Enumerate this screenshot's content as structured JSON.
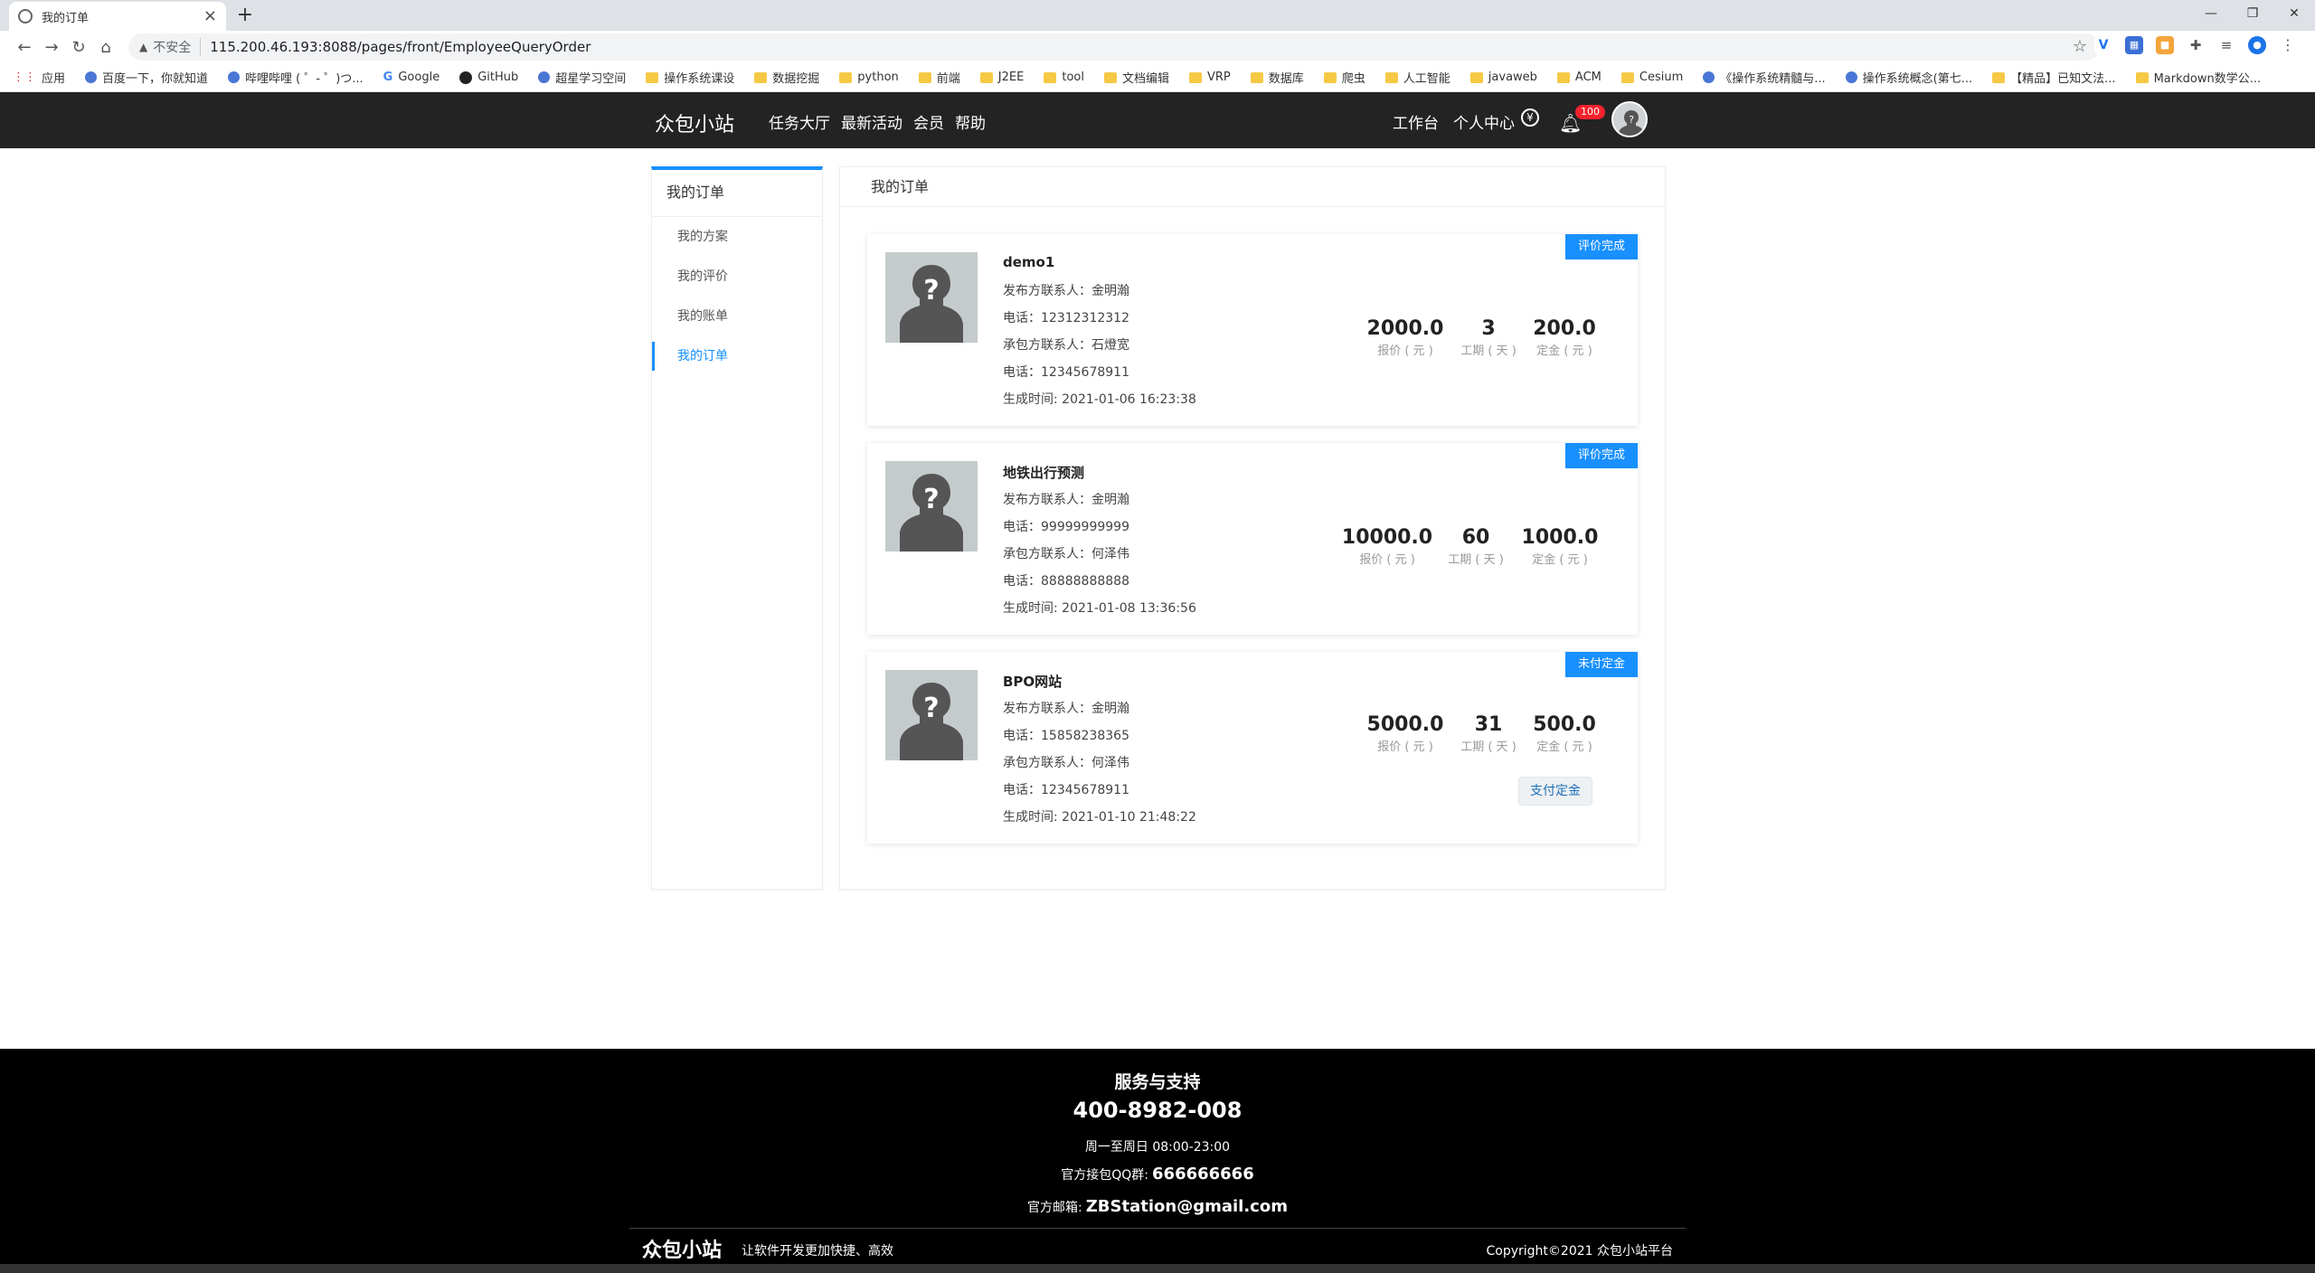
{
  "browser": {
    "tab_title": "我的订单",
    "new_tab": "+",
    "insecure_label": "不安全",
    "url": "115.200.46.193:8088/pages/front/EmployeeQueryOrder",
    "bookmarks": [
      "应用",
      "百度一下，你就知道",
      "哔哩哔哩 ( ゜- ゜)つ...",
      "Google",
      "GitHub",
      "超星学习空间",
      "操作系统课设",
      "数据挖掘",
      "python",
      "前端",
      "J2EE",
      "tool",
      "文档编辑",
      "VRP",
      "数据库",
      "爬虫",
      "人工智能",
      "javaweb",
      "ACM",
      "Cesium",
      "《操作系统精髓与...",
      "操作系统概念(第七...",
      "【精品】已知文法...",
      "Markdown数学公..."
    ]
  },
  "header": {
    "logo": "众包小站",
    "nav": [
      "任务大厅",
      "最新活动",
      "会员",
      "帮助"
    ],
    "right_nav": [
      "工作台",
      "个人中心"
    ],
    "coin_symbol": "¥",
    "notification_count": "100"
  },
  "sidebar": {
    "title": "我的订单",
    "items": [
      {
        "label": "我的方案",
        "active": false
      },
      {
        "label": "我的评价",
        "active": false
      },
      {
        "label": "我的账单",
        "active": false
      },
      {
        "label": "我的订单",
        "active": true
      }
    ]
  },
  "main": {
    "title": "我的订单",
    "orders": [
      {
        "name": "demo1",
        "status": "评价完成",
        "publisher": "发布方联系人：金明瀚",
        "publisher_phone": "电话：12312312312",
        "contractor": "承包方联系人：石燈宽",
        "contractor_phone": "电话：12345678911",
        "created": "生成时间: 2021-01-06 16:23:38",
        "price": "2000.0",
        "price_label": "报价 ( 元 )",
        "days": "3",
        "days_label": "工期 ( 天 )",
        "deposit": "200.0",
        "deposit_label": "定金 ( 元 )"
      },
      {
        "name": "地铁出行预测",
        "status": "评价完成",
        "publisher": "发布方联系人：金明瀚",
        "publisher_phone": "电话：99999999999",
        "contractor": "承包方联系人：何泽伟",
        "contractor_phone": "电话：88888888888",
        "created": "生成时间: 2021-01-08 13:36:56",
        "price": "10000.0",
        "price_label": "报价 ( 元 )",
        "days": "60",
        "days_label": "工期 ( 天 )",
        "deposit": "1000.0",
        "deposit_label": "定金 ( 元 )"
      },
      {
        "name": "BPO网站",
        "status": "未付定金",
        "publisher": "发布方联系人：金明瀚",
        "publisher_phone": "电话：15858238365",
        "contractor": "承包方联系人：何泽伟",
        "contractor_phone": "电话：12345678911",
        "created": "生成时间: 2021-01-10 21:48:22",
        "price": "5000.0",
        "price_label": "报价 ( 元 )",
        "days": "31",
        "days_label": "工期 ( 天 )",
        "deposit": "500.0",
        "deposit_label": "定金 ( 元 )",
        "action": "支付定金"
      }
    ]
  },
  "footer": {
    "title": "服务与支持",
    "phone": "400-8982-008",
    "hours": "周一至周日 08:00-23:00",
    "qq_label": "官方接包QQ群:",
    "qq": "666666666",
    "mail_label": "官方邮箱:",
    "mail": "ZBStation@gmail.com",
    "logo": "众包小站",
    "slogan": "让软件开发更加快捷、高效",
    "copyright": "Copyright©2021 众包小站平台"
  },
  "colors": {
    "accent": "#1890ff",
    "header_bg": "#232323",
    "footer_bg": "#000000"
  }
}
